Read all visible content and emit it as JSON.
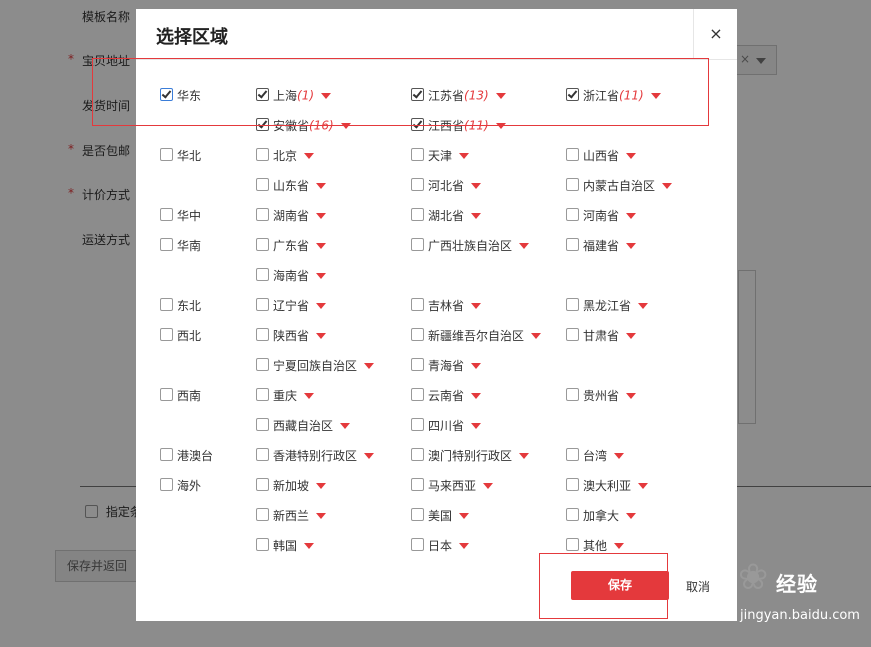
{
  "background": {
    "labels": [
      "模板名称",
      "宝贝地址",
      "发货时间",
      "是否包邮",
      "计价方式",
      "运送方式"
    ],
    "required_star": "*",
    "specified_label": "指定条",
    "save_return": "保存并返回"
  },
  "modal": {
    "title": "选择区域",
    "close": "×",
    "save": "保存",
    "cancel": "取消"
  },
  "regions": [
    {
      "name": "华东",
      "checked": true,
      "provinces": [
        {
          "name": "上海",
          "count": "(1)",
          "checked": true
        },
        {
          "name": "江苏省",
          "count": "(13)",
          "checked": true
        },
        {
          "name": "浙江省",
          "count": "(11)",
          "checked": true
        },
        {
          "name": "安徽省",
          "count": "(16)",
          "checked": true
        },
        {
          "name": "江西省",
          "count": "(11)",
          "checked": true
        }
      ]
    },
    {
      "name": "华北",
      "checked": false,
      "provinces": [
        {
          "name": "北京",
          "count": "",
          "checked": false
        },
        {
          "name": "天津",
          "count": "",
          "checked": false
        },
        {
          "name": "山西省",
          "count": "",
          "checked": false
        },
        {
          "name": "山东省",
          "count": "",
          "checked": false
        },
        {
          "name": "河北省",
          "count": "",
          "checked": false
        },
        {
          "name": "内蒙古自治区",
          "count": "",
          "checked": false
        }
      ]
    },
    {
      "name": "华中",
      "checked": false,
      "provinces": [
        {
          "name": "湖南省",
          "count": "",
          "checked": false
        },
        {
          "name": "湖北省",
          "count": "",
          "checked": false
        },
        {
          "name": "河南省",
          "count": "",
          "checked": false
        }
      ]
    },
    {
      "name": "华南",
      "checked": false,
      "provinces": [
        {
          "name": "广东省",
          "count": "",
          "checked": false
        },
        {
          "name": "广西壮族自治区",
          "count": "",
          "checked": false
        },
        {
          "name": "福建省",
          "count": "",
          "checked": false
        },
        {
          "name": "海南省",
          "count": "",
          "checked": false
        }
      ]
    },
    {
      "name": "东北",
      "checked": false,
      "provinces": [
        {
          "name": "辽宁省",
          "count": "",
          "checked": false
        },
        {
          "name": "吉林省",
          "count": "",
          "checked": false
        },
        {
          "name": "黑龙江省",
          "count": "",
          "checked": false
        }
      ]
    },
    {
      "name": "西北",
      "checked": false,
      "provinces": [
        {
          "name": "陕西省",
          "count": "",
          "checked": false
        },
        {
          "name": "新疆维吾尔自治区",
          "count": "",
          "checked": false
        },
        {
          "name": "甘肃省",
          "count": "",
          "checked": false
        },
        {
          "name": "宁夏回族自治区",
          "count": "",
          "checked": false
        },
        {
          "name": "青海省",
          "count": "",
          "checked": false
        }
      ]
    },
    {
      "name": "西南",
      "checked": false,
      "provinces": [
        {
          "name": "重庆",
          "count": "",
          "checked": false
        },
        {
          "name": "云南省",
          "count": "",
          "checked": false
        },
        {
          "name": "贵州省",
          "count": "",
          "checked": false
        },
        {
          "name": "西藏自治区",
          "count": "",
          "checked": false
        },
        {
          "name": "四川省",
          "count": "",
          "checked": false
        }
      ]
    },
    {
      "name": "港澳台",
      "checked": false,
      "provinces": [
        {
          "name": "香港特别行政区",
          "count": "",
          "checked": false
        },
        {
          "name": "澳门特别行政区",
          "count": "",
          "checked": false
        },
        {
          "name": "台湾",
          "count": "",
          "checked": false
        }
      ]
    },
    {
      "name": "海外",
      "checked": false,
      "provinces": [
        {
          "name": "新加坡",
          "count": "",
          "checked": false
        },
        {
          "name": "马来西亚",
          "count": "",
          "checked": false
        },
        {
          "name": "澳大利亚",
          "count": "",
          "checked": false
        },
        {
          "name": "新西兰",
          "count": "",
          "checked": false
        },
        {
          "name": "美国",
          "count": "",
          "checked": false
        },
        {
          "name": "加拿大",
          "count": "",
          "checked": false
        },
        {
          "name": "韩国",
          "count": "",
          "checked": false
        },
        {
          "name": "日本",
          "count": "",
          "checked": false
        },
        {
          "name": "其他",
          "count": "",
          "checked": false
        }
      ]
    }
  ],
  "watermark": {
    "brand": "经验",
    "url": "jingyan.baidu.com"
  },
  "colors": {
    "accent": "#e4393c",
    "count": "#e4393c"
  }
}
